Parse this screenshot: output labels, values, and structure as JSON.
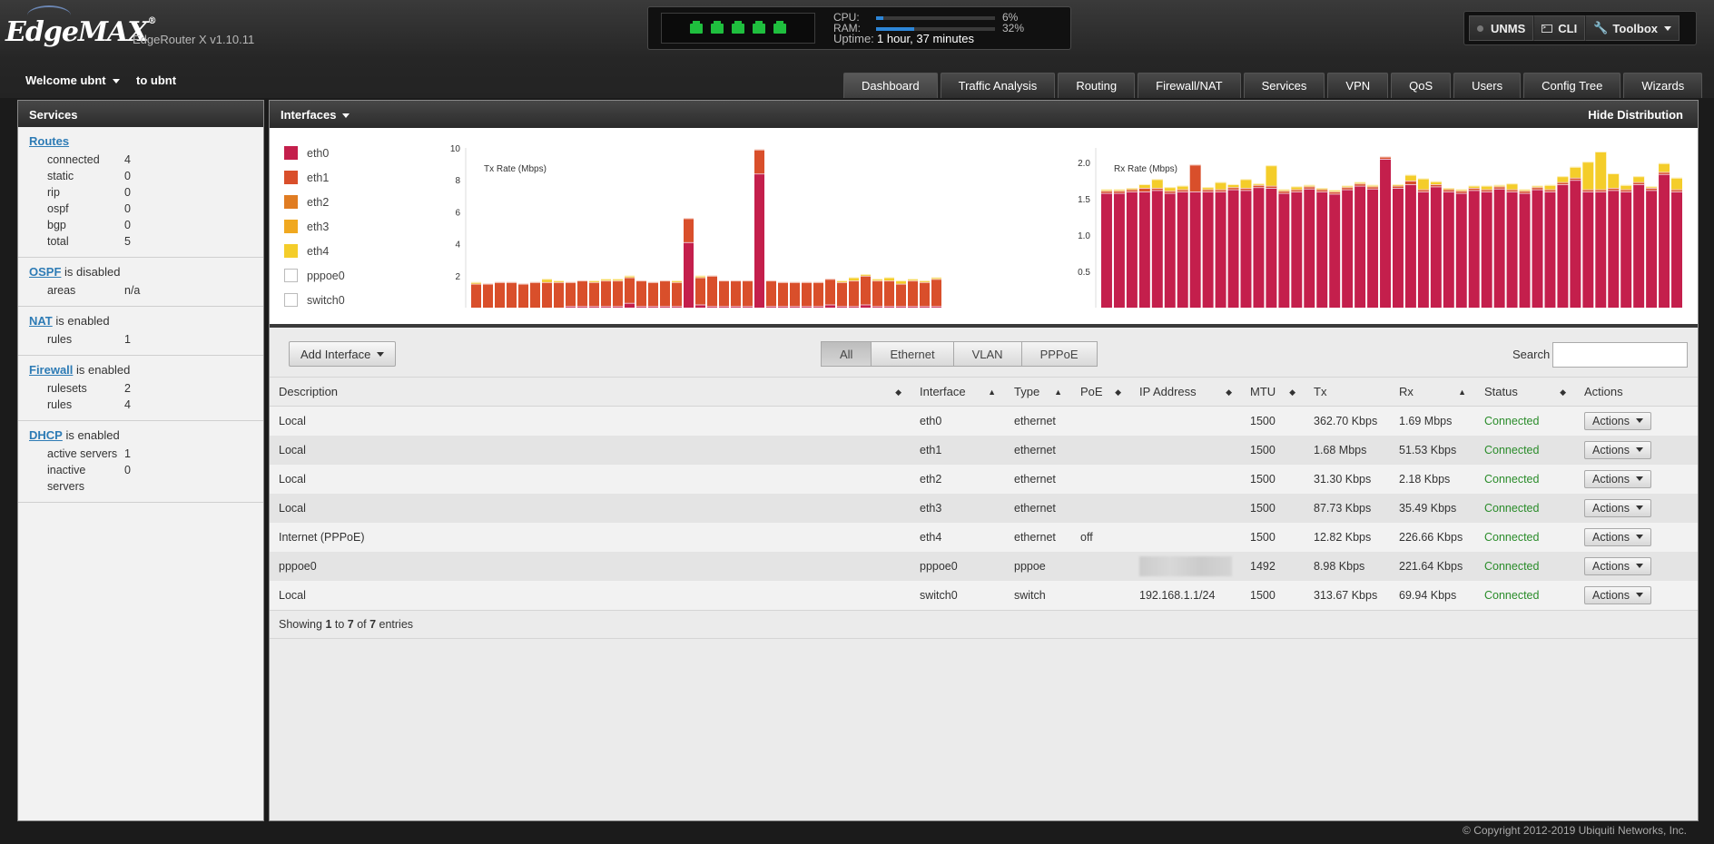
{
  "header": {
    "logo_text": "EdgeMAX",
    "logo_reg": "®",
    "router_version": "EdgeRouter X v1.10.11",
    "system": {
      "cpu_label": "CPU:",
      "cpu_pct": "6%",
      "cpu_value": 0.06,
      "ram_label": "RAM:",
      "ram_pct": "32%",
      "ram_value": 0.32,
      "uptime_label": "Uptime:",
      "uptime_value": "1 hour, 37 minutes",
      "ports_up": 5
    },
    "unms_label": "UNMS",
    "cli_label": "CLI",
    "toolbox_label": "Toolbox",
    "welcome_label": "Welcome ubnt",
    "welcome_to": "to ubnt"
  },
  "tabs": [
    "Dashboard",
    "Traffic Analysis",
    "Routing",
    "Firewall/NAT",
    "Services",
    "VPN",
    "QoS",
    "Users",
    "Config Tree",
    "Wizards"
  ],
  "sidebar": {
    "title": "Services",
    "routes": {
      "link": "Routes",
      "rows": [
        {
          "k": "connected",
          "v": "4"
        },
        {
          "k": "static",
          "v": "0"
        },
        {
          "k": "rip",
          "v": "0"
        },
        {
          "k": "ospf",
          "v": "0"
        },
        {
          "k": "bgp",
          "v": "0"
        },
        {
          "k": "total",
          "v": "5"
        }
      ]
    },
    "ospf": {
      "link": "OSPF",
      "status": " is disabled",
      "rows": [
        {
          "k": "areas",
          "v": "n/a"
        }
      ]
    },
    "nat": {
      "link": "NAT",
      "status": " is enabled",
      "rows": [
        {
          "k": "rules",
          "v": "1"
        }
      ]
    },
    "firewall": {
      "link": "Firewall",
      "status": " is enabled",
      "rows": [
        {
          "k": "rulesets",
          "v": "2"
        },
        {
          "k": "rules",
          "v": "4"
        }
      ]
    },
    "dhcp": {
      "link": "DHCP",
      "status": " is enabled",
      "rows": [
        {
          "k": "active servers",
          "v": "1"
        },
        {
          "k": "inactive servers",
          "v": "0"
        }
      ]
    }
  },
  "interfaces_panel": {
    "title": "Interfaces",
    "hide_distribution": "Hide Distribution",
    "legend": [
      {
        "name": "eth0",
        "color": "#c41f4c"
      },
      {
        "name": "eth1",
        "color": "#d94f2b"
      },
      {
        "name": "eth2",
        "color": "#e07c22"
      },
      {
        "name": "eth3",
        "color": "#f0a820"
      },
      {
        "name": "eth4",
        "color": "#f4cd2a"
      },
      {
        "name": "pppoe0",
        "color": "#ffffff"
      },
      {
        "name": "switch0",
        "color": "#ffffff"
      }
    ],
    "add_interface": "Add Interface",
    "filters": [
      "All",
      "Ethernet",
      "VLAN",
      "PPPoE"
    ],
    "search_label": "Search",
    "search_value": "",
    "columns": [
      "Description",
      "Interface",
      "Type",
      "PoE",
      "IP Address",
      "MTU",
      "Tx",
      "Rx",
      "Status",
      "Actions"
    ],
    "rows": [
      {
        "desc": "Local",
        "iface": "eth0",
        "type": "ethernet",
        "poe": "",
        "ip": "",
        "mtu": "1500",
        "tx": "362.70 Kbps",
        "rx": "1.69 Mbps",
        "status": "Connected",
        "action": "Actions"
      },
      {
        "desc": "Local",
        "iface": "eth1",
        "type": "ethernet",
        "poe": "",
        "ip": "",
        "mtu": "1500",
        "tx": "1.68 Mbps",
        "rx": "51.53 Kbps",
        "status": "Connected",
        "action": "Actions"
      },
      {
        "desc": "Local",
        "iface": "eth2",
        "type": "ethernet",
        "poe": "",
        "ip": "",
        "mtu": "1500",
        "tx": "31.30 Kbps",
        "rx": "2.18 Kbps",
        "status": "Connected",
        "action": "Actions"
      },
      {
        "desc": "Local",
        "iface": "eth3",
        "type": "ethernet",
        "poe": "",
        "ip": "",
        "mtu": "1500",
        "tx": "87.73 Kbps",
        "rx": "35.49 Kbps",
        "status": "Connected",
        "action": "Actions"
      },
      {
        "desc": "Internet (PPPoE)",
        "iface": "eth4",
        "type": "ethernet",
        "poe": "off",
        "ip": "",
        "mtu": "1500",
        "tx": "12.82 Kbps",
        "rx": "226.66 Kbps",
        "status": "Connected",
        "action": "Actions"
      },
      {
        "desc": "pppoe0",
        "iface": "pppoe0",
        "type": "pppoe",
        "poe": "",
        "ip": "",
        "ip_blurred": true,
        "mtu": "1492",
        "tx": "8.98 Kbps",
        "rx": "221.64 Kbps",
        "status": "Connected",
        "action": "Actions"
      },
      {
        "desc": "Local",
        "iface": "switch0",
        "type": "switch",
        "poe": "",
        "ip": "192.168.1.1/24",
        "mtu": "1500",
        "tx": "313.67 Kbps",
        "rx": "69.94 Kbps",
        "status": "Connected",
        "action": "Actions"
      }
    ],
    "showing": {
      "prefix": "Showing ",
      "from": "1",
      "to_word": " to ",
      "to": "7",
      "of_word": " of ",
      "total": "7",
      "suffix": " entries"
    }
  },
  "chart_data": [
    {
      "type": "bar",
      "title": "Tx Rate (Mbps)",
      "ylim": [
        0,
        10
      ],
      "yticks": [
        2,
        4,
        6,
        8,
        10
      ],
      "series": [
        {
          "name": "eth0",
          "color": "#c41f4c",
          "values": [
            0,
            0,
            0,
            0,
            0,
            0,
            0,
            0,
            0.1,
            0.1,
            0.1,
            0.1,
            0.1,
            0.3,
            0.1,
            0.1,
            0.1,
            0.1,
            4.1,
            0.2,
            0.1,
            0.1,
            0.1,
            0.1,
            8.4,
            0.1,
            0.1,
            0.1,
            0.1,
            0.1,
            0.2,
            0.1,
            0.1,
            0.2,
            0.1,
            0.1,
            0.1,
            0.1,
            0.1,
            0.1
          ]
        },
        {
          "name": "eth1",
          "color": "#d94f2b",
          "values": [
            1.5,
            1.5,
            1.6,
            1.6,
            1.5,
            1.6,
            1.6,
            1.6,
            1.5,
            1.6,
            1.5,
            1.6,
            1.6,
            1.6,
            1.6,
            1.5,
            1.6,
            1.5,
            1.5,
            1.7,
            1.9,
            1.6,
            1.6,
            1.6,
            1.5,
            1.6,
            1.5,
            1.5,
            1.5,
            1.5,
            1.6,
            1.5,
            1.6,
            1.8,
            1.6,
            1.6,
            1.4,
            1.6,
            1.5,
            1.7
          ]
        },
        {
          "name": "eth4",
          "color": "#f4cd2a",
          "values": [
            0.1,
            0,
            0,
            0,
            0,
            0,
            0.2,
            0.1,
            0,
            0,
            0.1,
            0.1,
            0.1,
            0.1,
            0,
            0,
            0,
            0.1,
            0,
            0.1,
            0,
            0,
            0,
            0,
            0,
            0,
            0,
            0,
            0,
            0,
            0,
            0.1,
            0.2,
            0.1,
            0.1,
            0.2,
            0.2,
            0.1,
            0.1,
            0.1
          ]
        }
      ]
    },
    {
      "type": "bar",
      "title": "Rx Rate (Mbps)",
      "ylim": [
        0,
        2.2
      ],
      "yticks": [
        0.5,
        1.0,
        1.5,
        2.0
      ],
      "series": [
        {
          "name": "eth0",
          "color": "#c41f4c",
          "values": [
            1.58,
            1.58,
            1.6,
            1.6,
            1.62,
            1.58,
            1.6,
            1.6,
            1.6,
            1.6,
            1.63,
            1.62,
            1.66,
            1.65,
            1.58,
            1.6,
            1.64,
            1.6,
            1.57,
            1.63,
            1.68,
            1.64,
            2.05,
            1.65,
            1.7,
            1.6,
            1.67,
            1.6,
            1.58,
            1.62,
            1.6,
            1.64,
            1.6,
            1.58,
            1.63,
            1.6,
            1.7,
            1.76,
            1.6,
            1.6,
            1.62,
            1.6,
            1.7,
            1.62,
            1.84,
            1.6
          ]
        },
        {
          "name": "eth1",
          "color": "#d94f2b",
          "values": [
            0.03,
            0.03,
            0.03,
            0.05,
            0.03,
            0.03,
            0.03,
            0.37,
            0.03,
            0.03,
            0.03,
            0.03,
            0.03,
            0.03,
            0.03,
            0.03,
            0.03,
            0.03,
            0.03,
            0.03,
            0.03,
            0.03,
            0.03,
            0.03,
            0.05,
            0.03,
            0.03,
            0.03,
            0.03,
            0.03,
            0.03,
            0.03,
            0.03,
            0.03,
            0.03,
            0.03,
            0.03,
            0.03,
            0.03,
            0.03,
            0.03,
            0.03,
            0.03,
            0.03,
            0.03,
            0.03
          ]
        },
        {
          "name": "eth4",
          "color": "#f4cd2a",
          "values": [
            0.02,
            0.02,
            0.02,
            0.05,
            0.12,
            0.05,
            0.05,
            0,
            0.03,
            0.1,
            0.04,
            0.12,
            0.02,
            0.28,
            0.02,
            0.04,
            0.02,
            0.02,
            0.02,
            0.02,
            0.02,
            0.02,
            0,
            0.02,
            0.08,
            0.15,
            0.04,
            0.02,
            0.02,
            0.03,
            0.05,
            0.02,
            0.08,
            0.02,
            0.02,
            0.06,
            0.08,
            0.15,
            0.38,
            0.52,
            0.2,
            0.06,
            0.08,
            0.02,
            0.12,
            0.16
          ]
        }
      ]
    }
  ],
  "footer": "© Copyright 2012-2019 Ubiquiti Networks, Inc."
}
